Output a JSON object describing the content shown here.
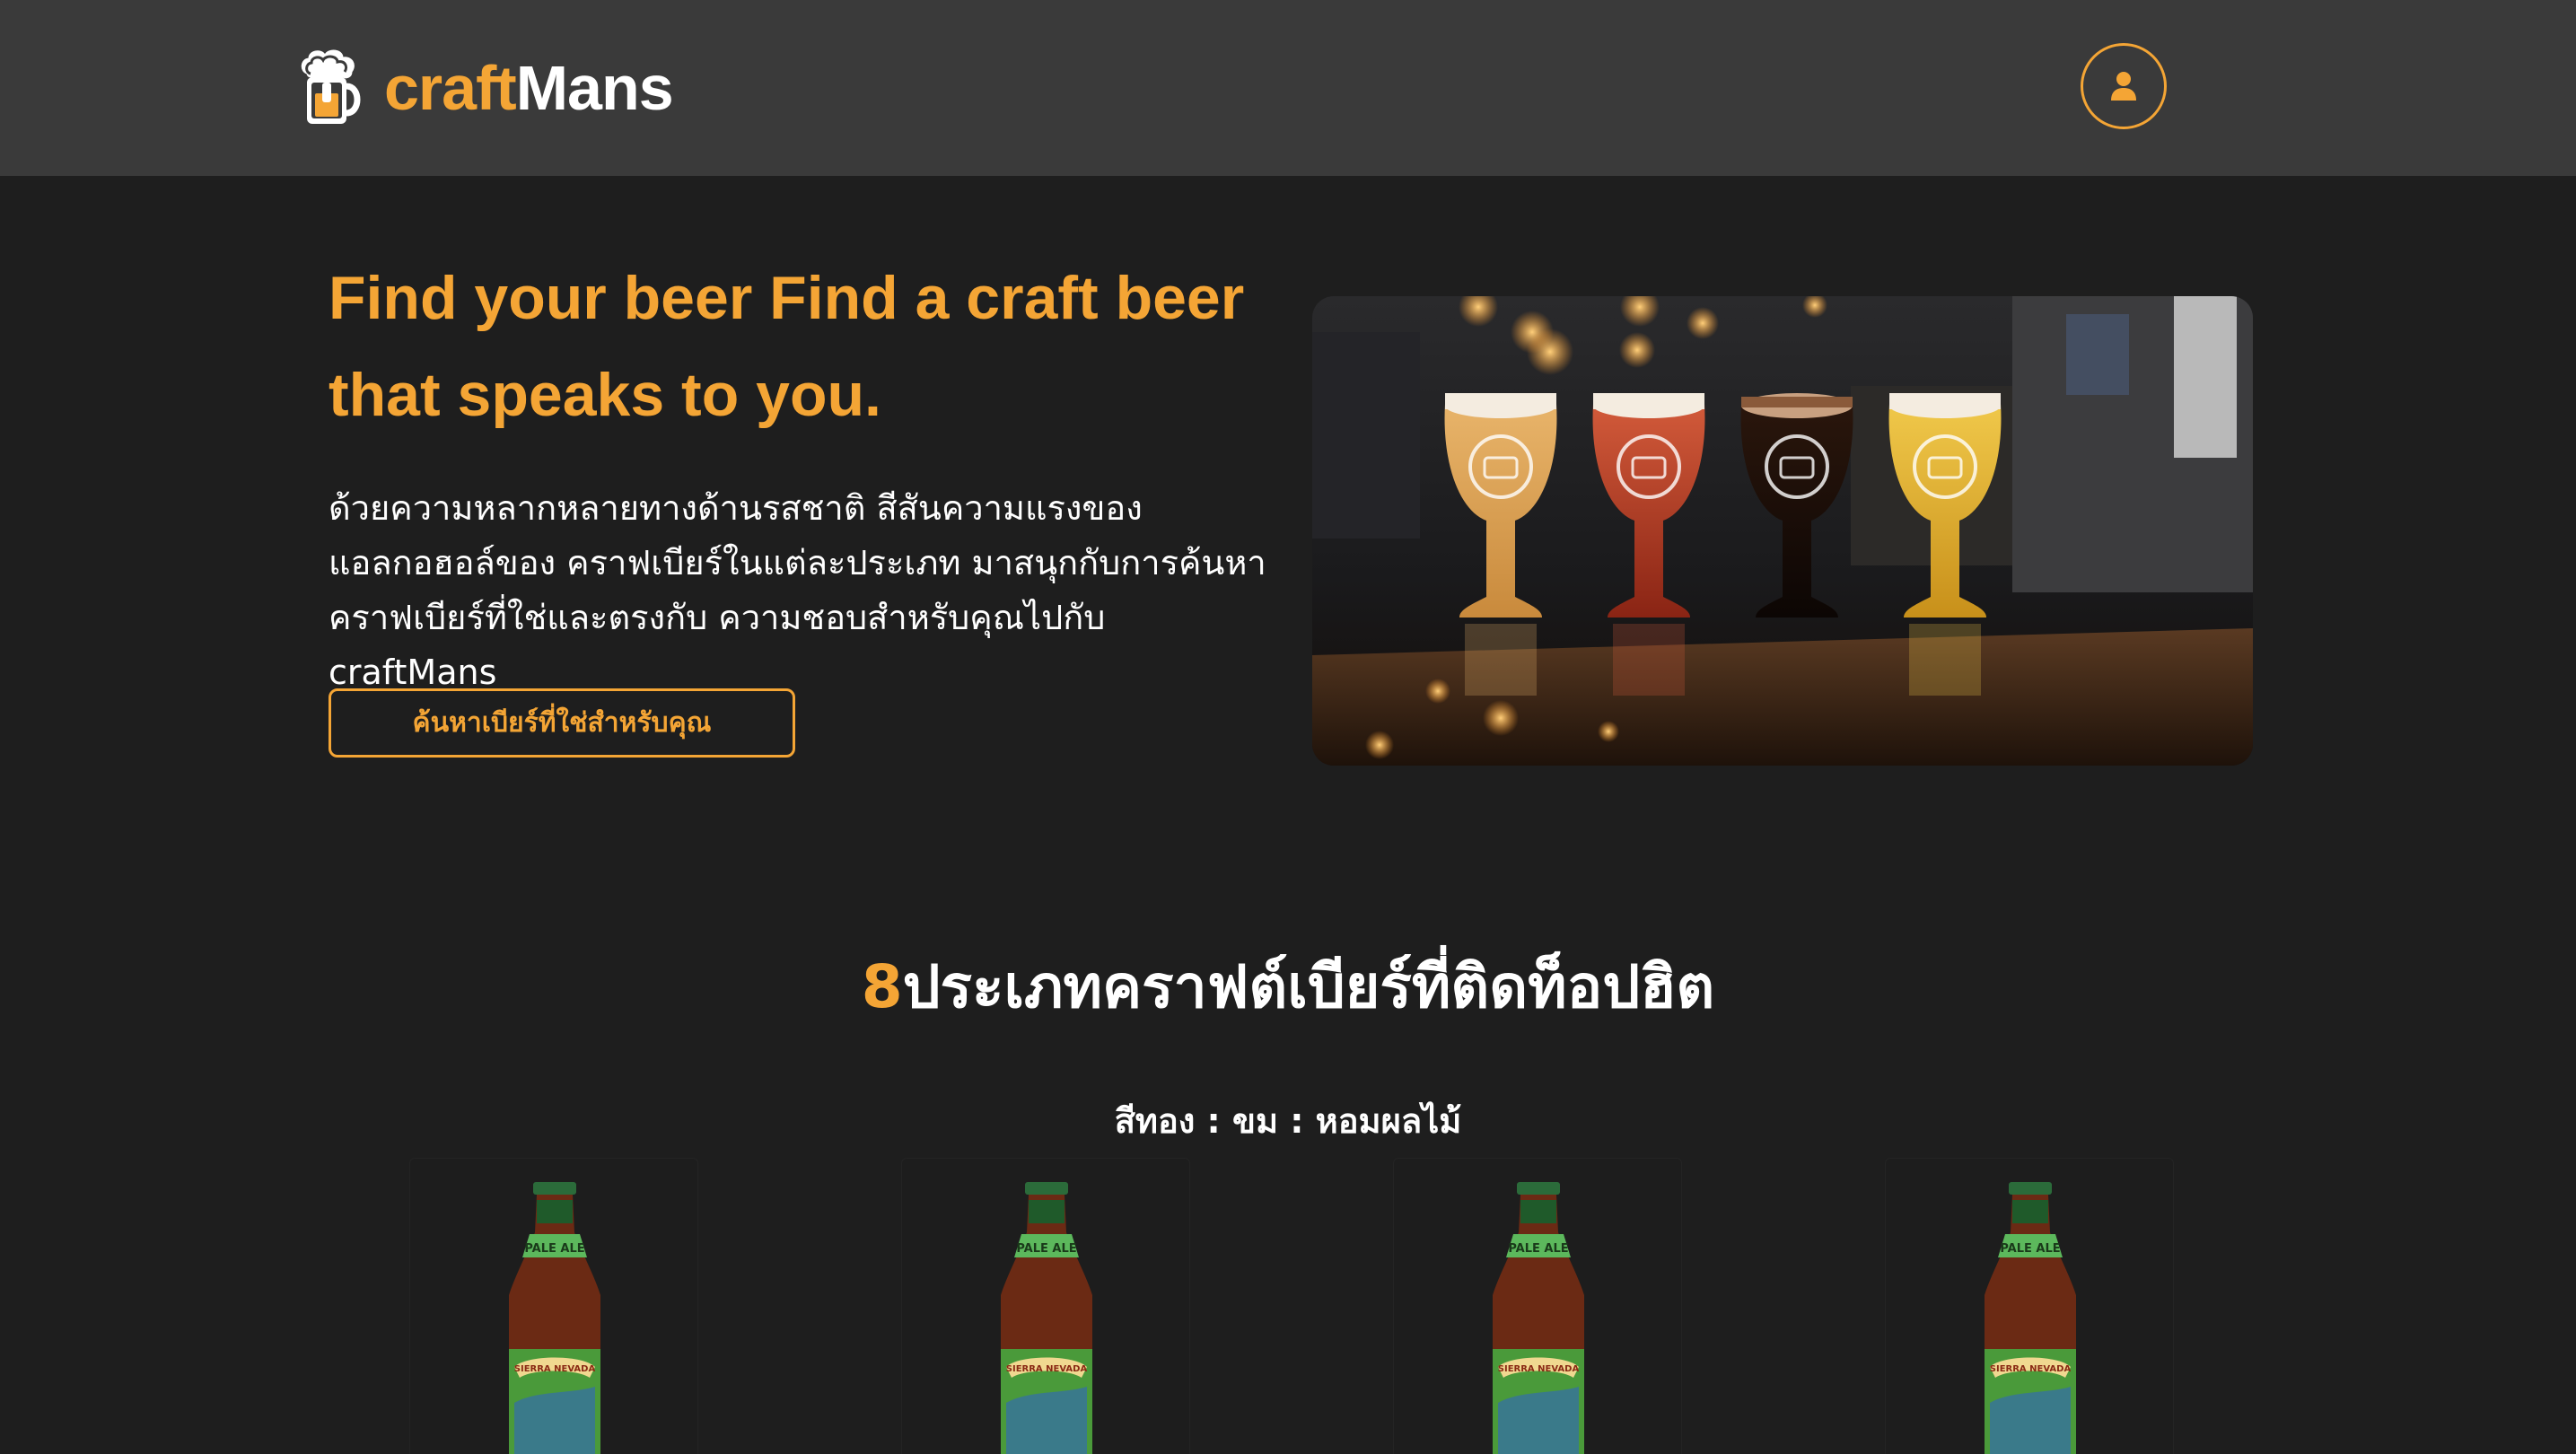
{
  "header": {
    "logo_craft": "craft",
    "logo_mans": "Mans",
    "logo_icon": "beer-mug-icon",
    "profile_icon": "user-icon"
  },
  "hero": {
    "title": "Find your beer Find a craft beer that speaks to you.",
    "description": "ด้วยความหลากหลายทางด้านรสชาติ สีสันความแรงของแอลกอฮอล์ของ คราฟเบียร์ในแต่ละประเภท มาสนุกกับการค้นหาคราฟเบียร์ที่ใช่และตรงกับ ความชอบสำหรับคุณไปกับ craftMans",
    "cta_label": "ค้นหาเบียร์ที่ใช่สำหรับคุณ",
    "image_subject": "four craft beer glasses on a bar counter"
  },
  "categories_section": {
    "title_number": "8",
    "title_text": "ประเภทคราฟต์เบียร์ที่ติดท็อปฮิต",
    "subtitle": "สีทอง : ขม : หอมผลไม้",
    "products": [
      {
        "label": "PALE ALE",
        "brand": "SIERRA NEVADA"
      },
      {
        "label": "PALE ALE",
        "brand": "SIERRA NEVADA"
      },
      {
        "label": "PALE ALE",
        "brand": "SIERRA NEVADA"
      },
      {
        "label": "PALE ALE",
        "brand": "SIERRA NEVADA"
      }
    ]
  },
  "colors": {
    "accent": "#f4a535",
    "header_bg": "#3a3a3a",
    "page_bg": "#1e1e1e"
  }
}
